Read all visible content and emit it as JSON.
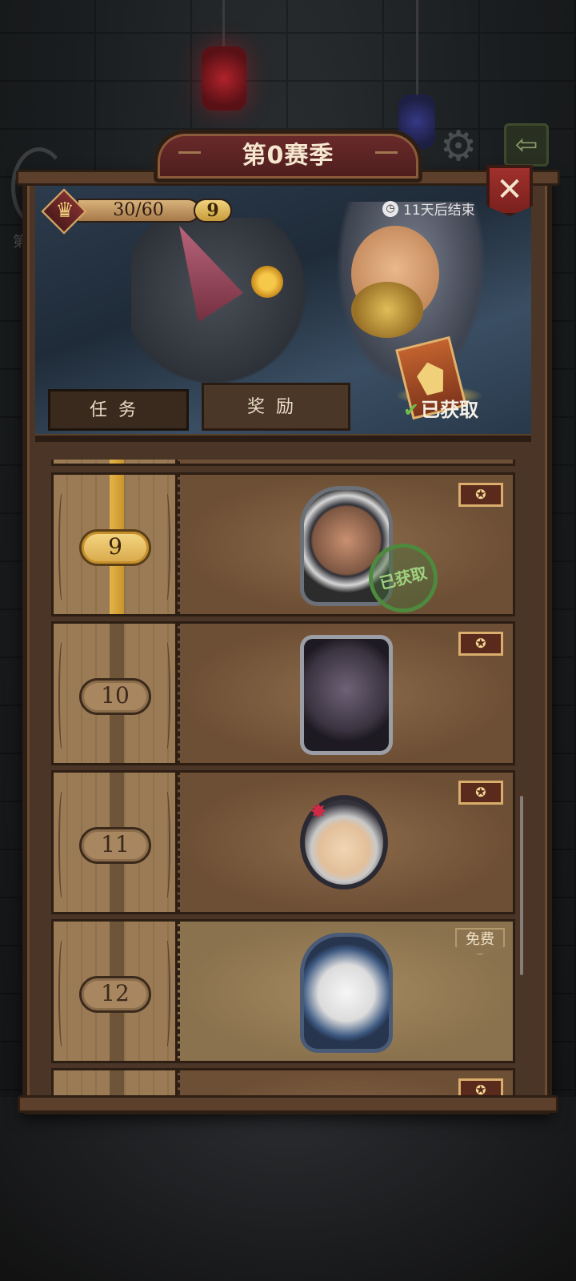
{
  "season": {
    "title": "第0赛季"
  },
  "header": {
    "progress_text": "30/60",
    "level": "9",
    "timer_text": "11天后结束"
  },
  "tabs": [
    {
      "label": "任务"
    },
    {
      "label": "奖励"
    }
  ],
  "obtained_label": "已获取",
  "rows": [
    {
      "level": "9",
      "tag": "premium",
      "claimed": true,
      "stamp": "已获取"
    },
    {
      "level": "10",
      "tag": "premium",
      "claimed": false
    },
    {
      "level": "11",
      "tag": "premium",
      "claimed": false
    },
    {
      "level": "12",
      "tag": "free",
      "claimed": false,
      "free_label": "免费"
    }
  ],
  "icons": {
    "close": "close-icon",
    "settings": "gear-icon",
    "back": "back-arrow-icon",
    "crown": "crown-icon",
    "clock": "clock-icon",
    "check": "check-icon"
  },
  "colors": {
    "active_level": "#d7a849",
    "claimed_stamp": "#4e8a3d",
    "close_button": "#a0302c"
  }
}
